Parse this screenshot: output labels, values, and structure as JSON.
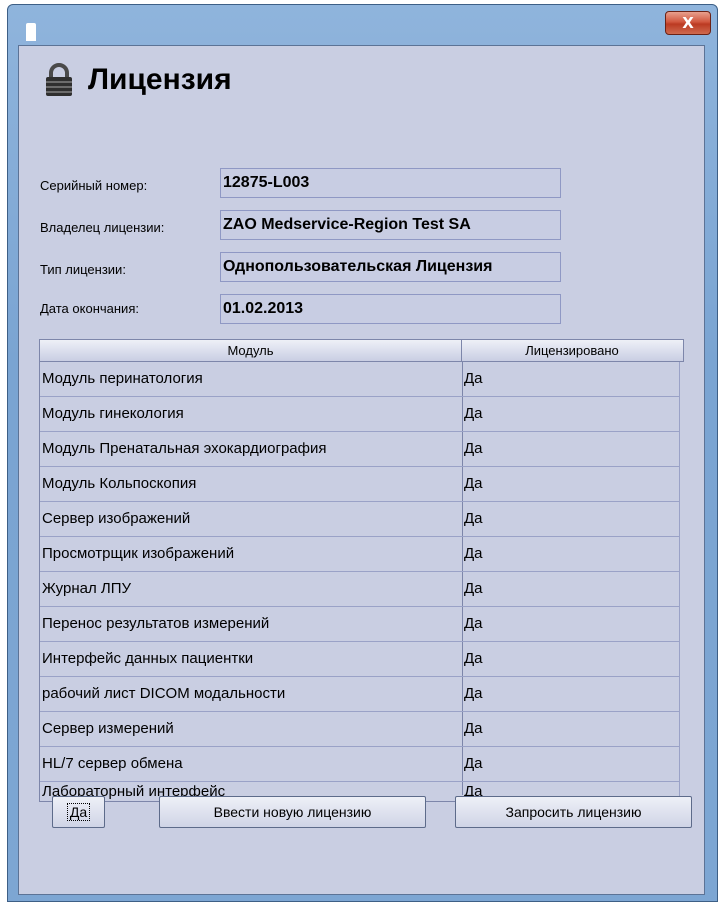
{
  "window": {
    "close_label": "X"
  },
  "header": {
    "title": "Лицензия",
    "icon": "lock-icon"
  },
  "fields": {
    "serial_label": "Серийный номер:",
    "serial_value": "12875-L003",
    "owner_label": "Владелец лицензии:",
    "owner_value": "ZAO Medservice-Region Test SA",
    "type_label": "Тип лицензии:",
    "type_value": "Однопользовательская Лицензия",
    "expiry_label": "Дата окончания:",
    "expiry_value": "01.02.2013"
  },
  "table": {
    "columns": [
      "Модуль",
      "Лицензировано"
    ],
    "rows": [
      {
        "module": "Модуль перинатология",
        "licensed": "Да"
      },
      {
        "module": "Модуль гинекология",
        "licensed": "Да"
      },
      {
        "module": "Модуль Пренатальная эхокардиография",
        "licensed": "Да"
      },
      {
        "module": "Модуль Кольпоскопия",
        "licensed": "Да"
      },
      {
        "module": "Сервер изображений",
        "licensed": "Да"
      },
      {
        "module": "Просмотрщик изображений",
        "licensed": "Да"
      },
      {
        "module": "Журнал ЛПУ",
        "licensed": "Да"
      },
      {
        "module": "Перенос результатов измерений",
        "licensed": "Да"
      },
      {
        "module": "Интерфейс данных пациентки",
        "licensed": "Да"
      },
      {
        "module": "рабочий лист DICOM модальности",
        "licensed": "Да"
      },
      {
        "module": "Сервер измерений",
        "licensed": "Да"
      },
      {
        "module": "HL/7 сервер обмена",
        "licensed": "Да"
      },
      {
        "module": "Лабораторный интерфейс",
        "licensed": "Да"
      }
    ]
  },
  "buttons": {
    "ok": "Да",
    "enter_new": "Ввести новую лицензию",
    "request": "Запросить лицензию"
  }
}
